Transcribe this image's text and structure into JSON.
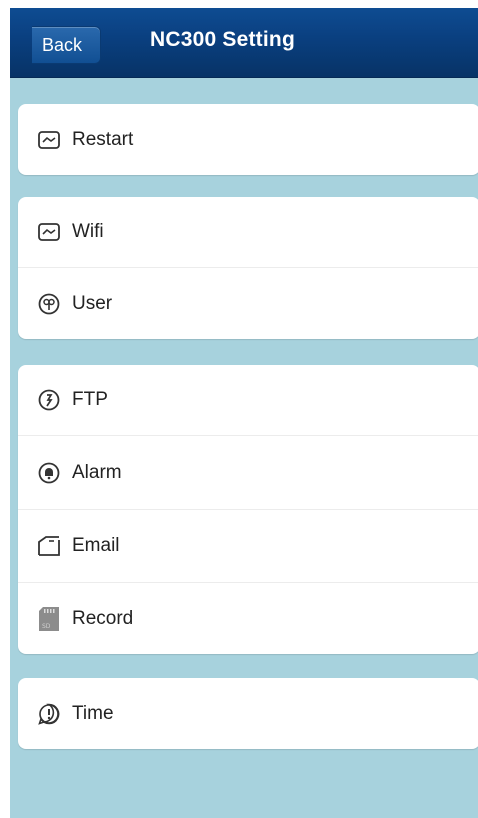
{
  "nav": {
    "back_label": "Back",
    "title": "NC300  Setting"
  },
  "groups": [
    {
      "items": [
        {
          "label": "Restart",
          "icon": "restart-icon"
        }
      ]
    },
    {
      "items": [
        {
          "label": "Wifi",
          "icon": "wifi-icon"
        },
        {
          "label": "User",
          "icon": "user-icon"
        }
      ]
    },
    {
      "items": [
        {
          "label": "FTP",
          "icon": "ftp-icon"
        },
        {
          "label": "Alarm",
          "icon": "alarm-icon"
        },
        {
          "label": "Email",
          "icon": "email-icon"
        },
        {
          "label": "Record",
          "icon": "sd-card-icon",
          "icon_text": "SD"
        }
      ]
    },
    {
      "items": [
        {
          "label": "Time",
          "icon": "time-icon"
        }
      ]
    }
  ],
  "colors": {
    "navbar": "#0a3f7f",
    "background": "#a7d2dd",
    "cell": "#ffffff"
  }
}
